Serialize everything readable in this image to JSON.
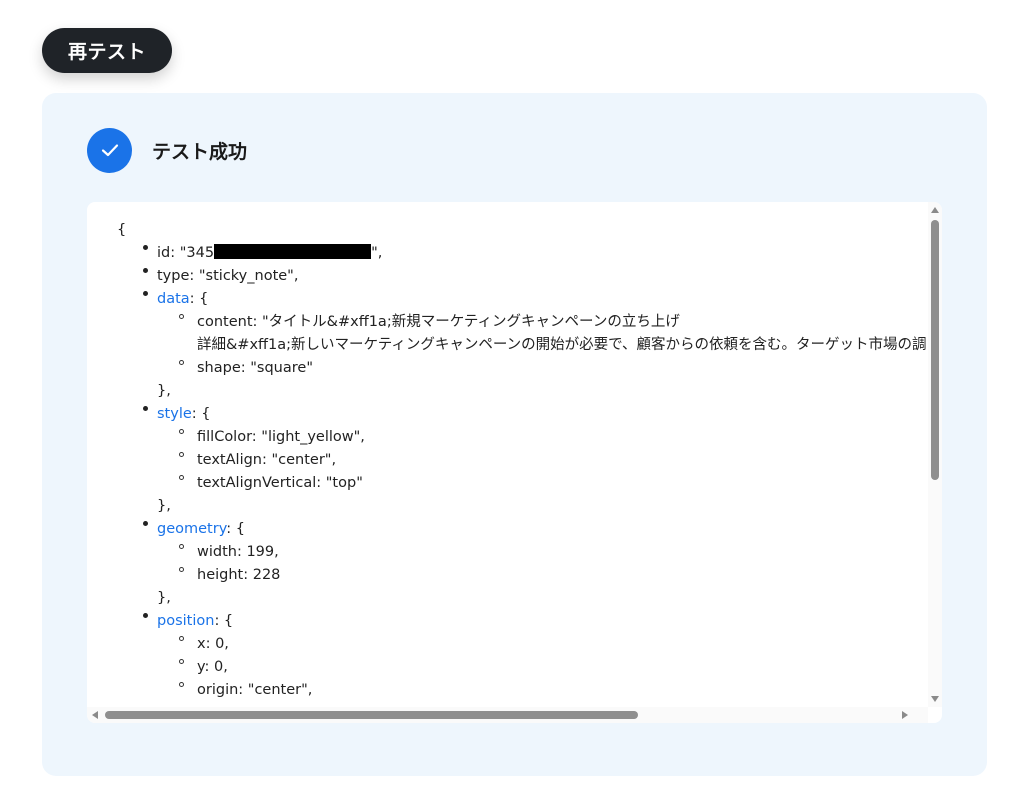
{
  "retest_button": {
    "label": "再テスト"
  },
  "status": {
    "text": "テスト成功",
    "icon": "checkmark-icon",
    "color": "#1a73e8"
  },
  "code": {
    "open_brace": "{",
    "id_prefix": "id: \"345",
    "id_suffix": "\",",
    "type_line": "type: \"sticky_note\",",
    "data_key": "data",
    "open_obj": ": {",
    "content_line1": "content: \"タイトル&#xff1a;新規マーケティングキャンペーンの立ち上げ",
    "content_line2": "詳細&#xff1a;新しいマーケティングキャンペーンの開始が必要で、顧客からの依頼を含む。ターゲット市場の調",
    "shape_line": "shape: \"square\"",
    "close_obj": "},",
    "style_key": "style",
    "fill_line": "fillColor: \"light_yellow\",",
    "align_line": "textAlign: \"center\",",
    "valign_line": "textAlignVertical: \"top\"",
    "geometry_key": "geometry",
    "width_line": "width: 199,",
    "height_line": "height: 228",
    "position_key": "position",
    "x_line": "x: 0,",
    "y_line": "y: 0,",
    "origin_line": "origin: \"center\","
  },
  "colors": {
    "panel_bg": "#eef6fd",
    "button_bg": "#1f2328",
    "key_link": "#1a73e8"
  }
}
